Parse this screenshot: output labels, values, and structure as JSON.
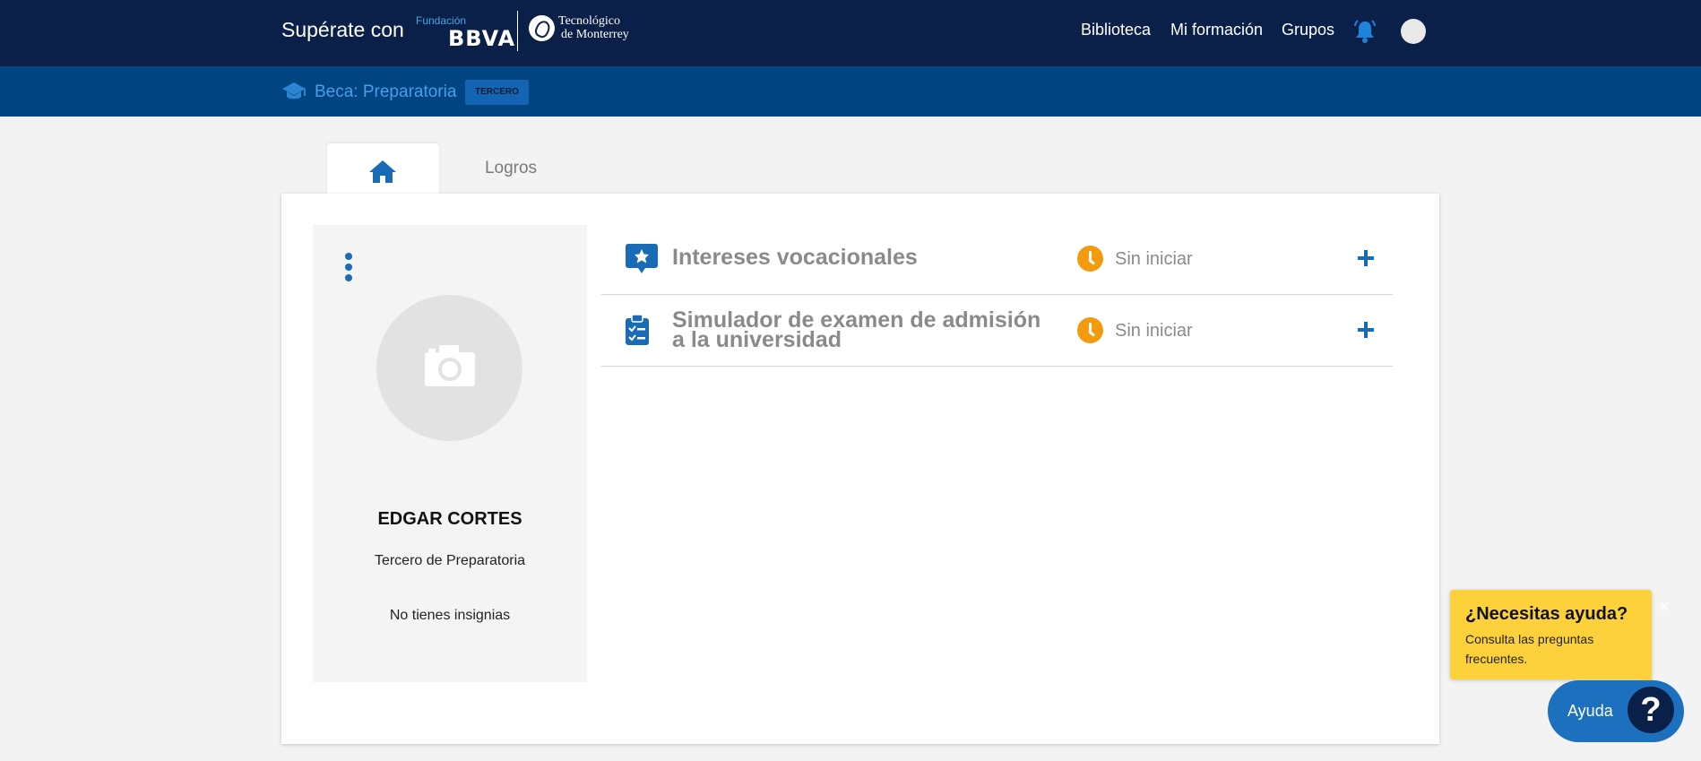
{
  "header": {
    "brand_text": "Supérate con",
    "logo_bbva_small": "Fundación",
    "logo_bbva_name": "BBVA",
    "logo_tec_line1": "Tecnológico",
    "logo_tec_line2": "de Monterrey",
    "nav": [
      {
        "label": "Biblioteca"
      },
      {
        "label": "Mi formación"
      },
      {
        "label": "Grupos"
      }
    ],
    "icons": {
      "notifications": "bell-icon",
      "profile": "avatar"
    }
  },
  "subheader": {
    "icon": "graduation-cap-icon",
    "title": "Beca: Preparatoria",
    "badge": "TERCERO"
  },
  "tabs": [
    {
      "icon": "home-icon",
      "active": true
    },
    {
      "label": "Logros",
      "active": false
    }
  ],
  "profile": {
    "menu_icon": "kebab-menu-icon",
    "photo_icon": "camera-icon",
    "name": "EDGAR CORTES",
    "grade": "Tercero de Preparatoria",
    "badges": "No tienes insignias"
  },
  "activities": [
    {
      "icon": "star-chat-icon",
      "title_line1": "Intereses vocacionales",
      "title_line2": "",
      "status": "Sin iniciar",
      "status_icon": "clock-icon"
    },
    {
      "icon": "clipboard-checklist-icon",
      "title_line1": "Simulador de examen de admisión",
      "title_line2": "a la universidad",
      "status": "Sin iniciar",
      "status_icon": "clock-icon"
    }
  ],
  "help": {
    "title": "¿Necesitas ayuda?",
    "text": "Consulta las preguntas frecuentes.",
    "close": "×",
    "button_label": "Ayuda",
    "button_icon": "?"
  },
  "colors": {
    "topbar": "#0b2049",
    "subbar": "#004481",
    "accent": "#1a6bb5",
    "status_orange": "#f39a0f",
    "help_yellow": "#fdd13b"
  }
}
